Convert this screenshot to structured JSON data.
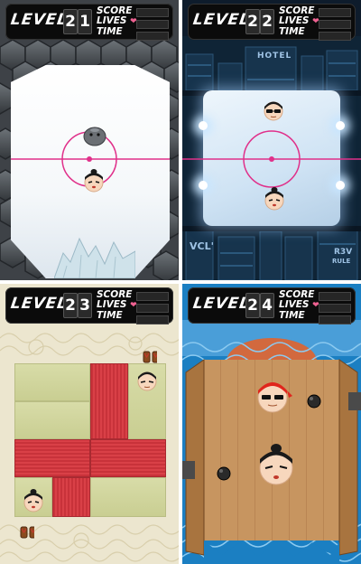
{
  "panels": [
    {
      "id": "level-21",
      "hud": {
        "level_label": "LEVEL",
        "level_digits": [
          "2",
          "1"
        ],
        "score_label": "SCORE",
        "lives_label": "LIVES",
        "time_label": "TIME",
        "heart_icon": "heart-icon"
      },
      "theme": "hexagon ice rink"
    },
    {
      "id": "level-22",
      "hud": {
        "level_label": "LEVEL",
        "level_digits": [
          "2",
          "2"
        ],
        "score_label": "SCORE",
        "lives_label": "LIVES",
        "time_label": "TIME",
        "heart_icon": "heart-icon"
      },
      "theme": "city ice rink",
      "signs": {
        "hotel": "HOTEL",
        "vcl": "VCL'",
        "rev": "R3V",
        "rev2": "RULE"
      }
    },
    {
      "id": "level-23",
      "hud": {
        "level_label": "LEVEL",
        "level_digits": [
          "2",
          "3"
        ],
        "score_label": "SCORE",
        "lives_label": "LIVES",
        "time_label": "TIME",
        "heart_icon": "heart-icon"
      },
      "theme": "tatami mats"
    },
    {
      "id": "level-24",
      "hud": {
        "level_label": "LEVEL",
        "level_digits": [
          "2",
          "4"
        ],
        "score_label": "SCORE",
        "lives_label": "LIVES",
        "time_label": "TIME",
        "heart_icon": "heart-icon"
      },
      "theme": "wooden boat deck"
    }
  ],
  "colors": {
    "hud_bg": "#0b0b0b",
    "center_line": "#e0308a",
    "tatami_red": "#d23c44",
    "tatami_green": "#d0d49c",
    "sea_blue": "#1b7fc2",
    "wood": "#c79560",
    "bandana_red": "#e0251c"
  }
}
